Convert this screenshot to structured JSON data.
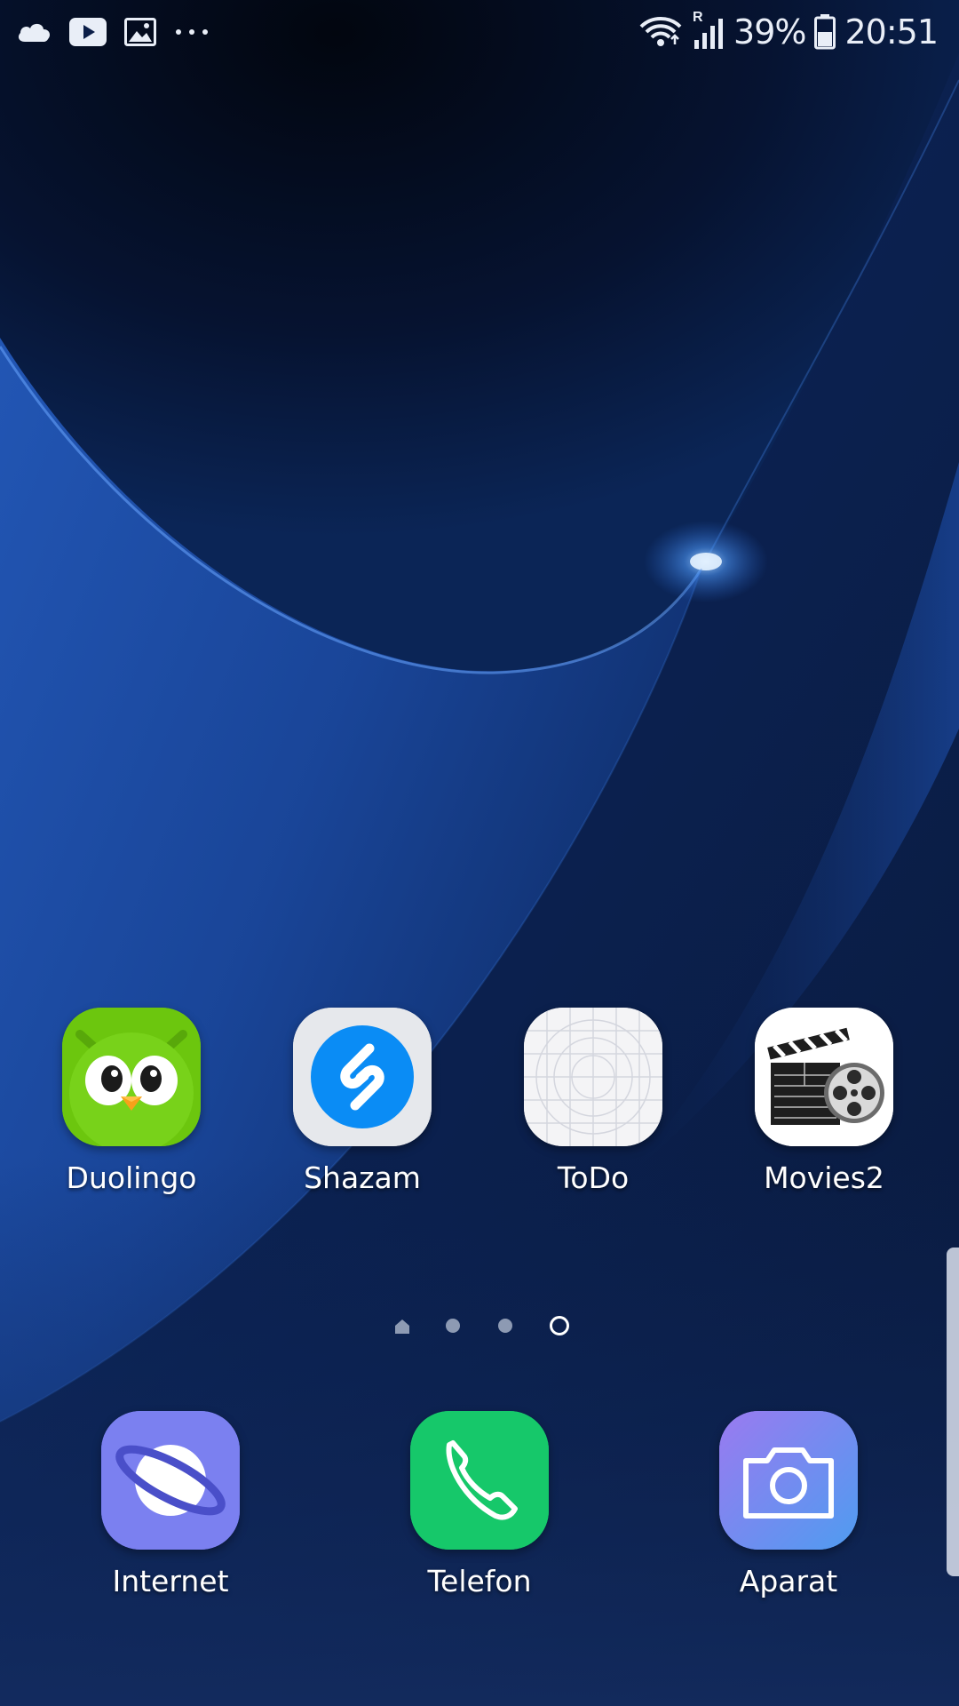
{
  "status_bar": {
    "left_icons": [
      "cloud-icon",
      "youtube-icon",
      "gallery-icon",
      "more-icon"
    ],
    "right_icons": [
      "wifi-icon",
      "signal-icon",
      "battery-icon"
    ],
    "roaming_label": "R",
    "battery_percent": "39%",
    "time": "20:51"
  },
  "apps": [
    {
      "label": "Duolingo",
      "icon": "duolingo-owl-icon"
    },
    {
      "label": "Shazam",
      "icon": "shazam-icon"
    },
    {
      "label": "ToDo",
      "icon": "todo-placeholder-icon"
    },
    {
      "label": "Movies2",
      "icon": "clapperboard-film-reel-icon"
    }
  ],
  "page_indicator": {
    "pages": 4,
    "active_page": 4,
    "first_page_icon": "home-icon"
  },
  "dock": [
    {
      "label": "Internet",
      "icon": "internet-planet-icon"
    },
    {
      "label": "Telefon",
      "icon": "phone-icon"
    },
    {
      "label": "Aparat",
      "icon": "camera-icon"
    }
  ],
  "colors": {
    "wallpaper_dark": "#050c22",
    "wallpaper_blue": "#1d4a9a",
    "duolingo_green": "#6cc60e",
    "shazam_blue": "#0a8cf5",
    "internet_purple": "#7b80f0",
    "phone_green": "#16c86a",
    "camera_gradient_start": "#9a7af0",
    "camera_gradient_end": "#4f9cf0"
  }
}
